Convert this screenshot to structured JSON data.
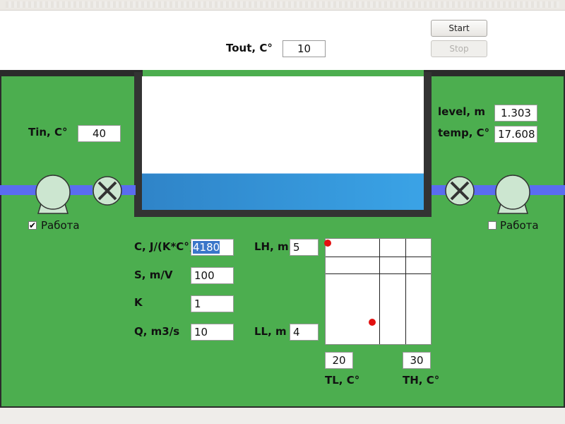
{
  "header": {
    "tout_label": "Tout, C°",
    "tout_value": "10",
    "start_label": "Start",
    "stop_label": "Stop"
  },
  "inlet": {
    "tin_label": "Tin, C°",
    "tin_value": "40",
    "pump_checkbox_label": "Работа",
    "pump_checked": true
  },
  "outlet": {
    "level_label": "level, m",
    "level_value": "1.303",
    "temp_label": "temp, C°",
    "temp_value": "17.608",
    "pump_checkbox_label": "Работа",
    "pump_checked": false
  },
  "params": {
    "c_label": "C, J/(K*C°)",
    "c_value": "4180",
    "s_label": "S, m/V",
    "s_value": "100",
    "k_label": "K",
    "k_value": "1",
    "q_label": "Q, m3/s",
    "q_value": "10",
    "lh_label": "LH, m",
    "lh_value": "5",
    "ll_label": "LL, m",
    "ll_value": "4"
  },
  "graph": {
    "tl_label": "TL, C°",
    "tl_value": "20",
    "th_label": "TH, C°",
    "th_value": "30"
  },
  "tank": {
    "fill_fraction": 0.26
  },
  "colors": {
    "background_green": "#4cae4f",
    "water": "#3aa3e6",
    "pipe": "#5a6cf0",
    "marker": "#e21010"
  }
}
